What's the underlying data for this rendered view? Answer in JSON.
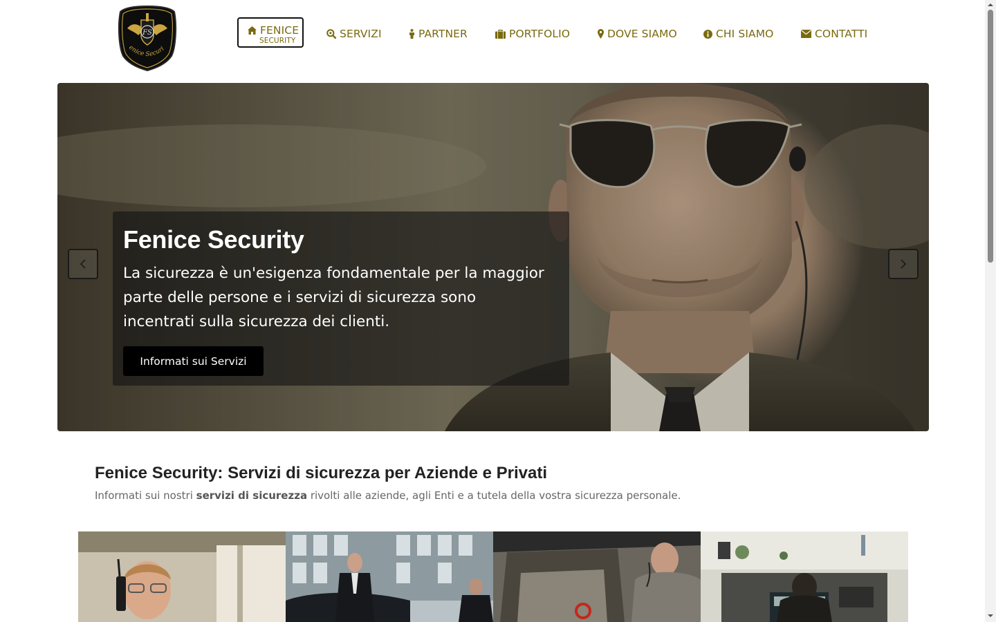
{
  "brand": {
    "logo_icon": "phoenix-shield-logo",
    "logo_text": "Fenice Security"
  },
  "nav": {
    "home": {
      "label": "FENICE",
      "sub": "SECURITY",
      "icon": "home-icon"
    },
    "items": [
      {
        "label": "SERVIZI",
        "icon": "search-icon"
      },
      {
        "label": "PARTNER",
        "icon": "person-icon"
      },
      {
        "label": "PORTFOLIO",
        "icon": "briefcase-icon"
      },
      {
        "label": "DOVE SIAMO",
        "icon": "map-marker-icon"
      },
      {
        "label": "CHI SIAMO",
        "icon": "info-icon"
      },
      {
        "label": "CONTATTI",
        "icon": "envelope-icon"
      }
    ]
  },
  "hero": {
    "title": "Fenice Security",
    "text": "La sicurezza è un'esigenza fondamentale per la maggior parte delle persone e i servizi di sicurezza sono incentrati sulla sicurezza dei clienti.",
    "cta": "Informati sui Servizi",
    "prev_icon": "chevron-left-icon",
    "next_icon": "chevron-right-icon"
  },
  "intro": {
    "title": "Fenice Security: Servizi di sicurezza per Aziende e Privati",
    "sub_before": "Informati sui nostri ",
    "sub_bold": "servizi di sicurezza",
    "sub_after": " rivolti alle aziende, agli Enti e a tutela della vostra sicurezza personale."
  },
  "colors": {
    "nav_text": "#7a6a0f",
    "caption_bg": "#141414",
    "cta_bg": "#000000"
  }
}
